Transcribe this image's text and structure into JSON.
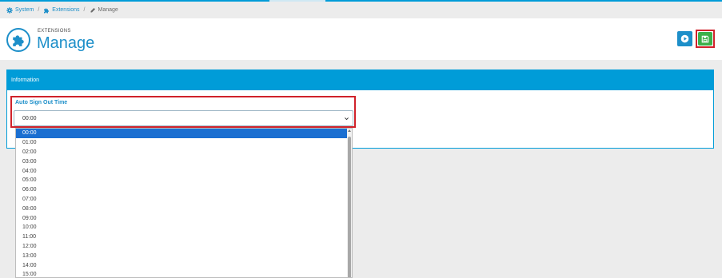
{
  "breadcrumb": {
    "system": "System",
    "sep1": "/",
    "extensions": "Extensions",
    "sep2": "/",
    "current": "Manage"
  },
  "header": {
    "eyebrow": "EXTENSIONS",
    "title": "Manage"
  },
  "panel": {
    "heading": "Information"
  },
  "field": {
    "label": "Auto Sign Out Time",
    "selected_value": "00:00"
  },
  "options": [
    "00:00",
    "01:00",
    "02:00",
    "03:00",
    "04:00",
    "05:00",
    "06:00",
    "07:00",
    "08:00",
    "09:00",
    "10:00",
    "11:00",
    "12:00",
    "13:00",
    "14:00",
    "15:00"
  ],
  "icons": {
    "system": "gear-icon",
    "extensions": "puzzle-icon",
    "manage": "pencil-icon",
    "header": "puzzle-icon",
    "play": "play-circle-icon",
    "save": "save-icon"
  },
  "colors": {
    "accent": "#009cd8",
    "link": "#1d8fc9",
    "save": "#3cb04a",
    "highlight": "#d0222a",
    "selected_option": "#1b6fd1"
  }
}
